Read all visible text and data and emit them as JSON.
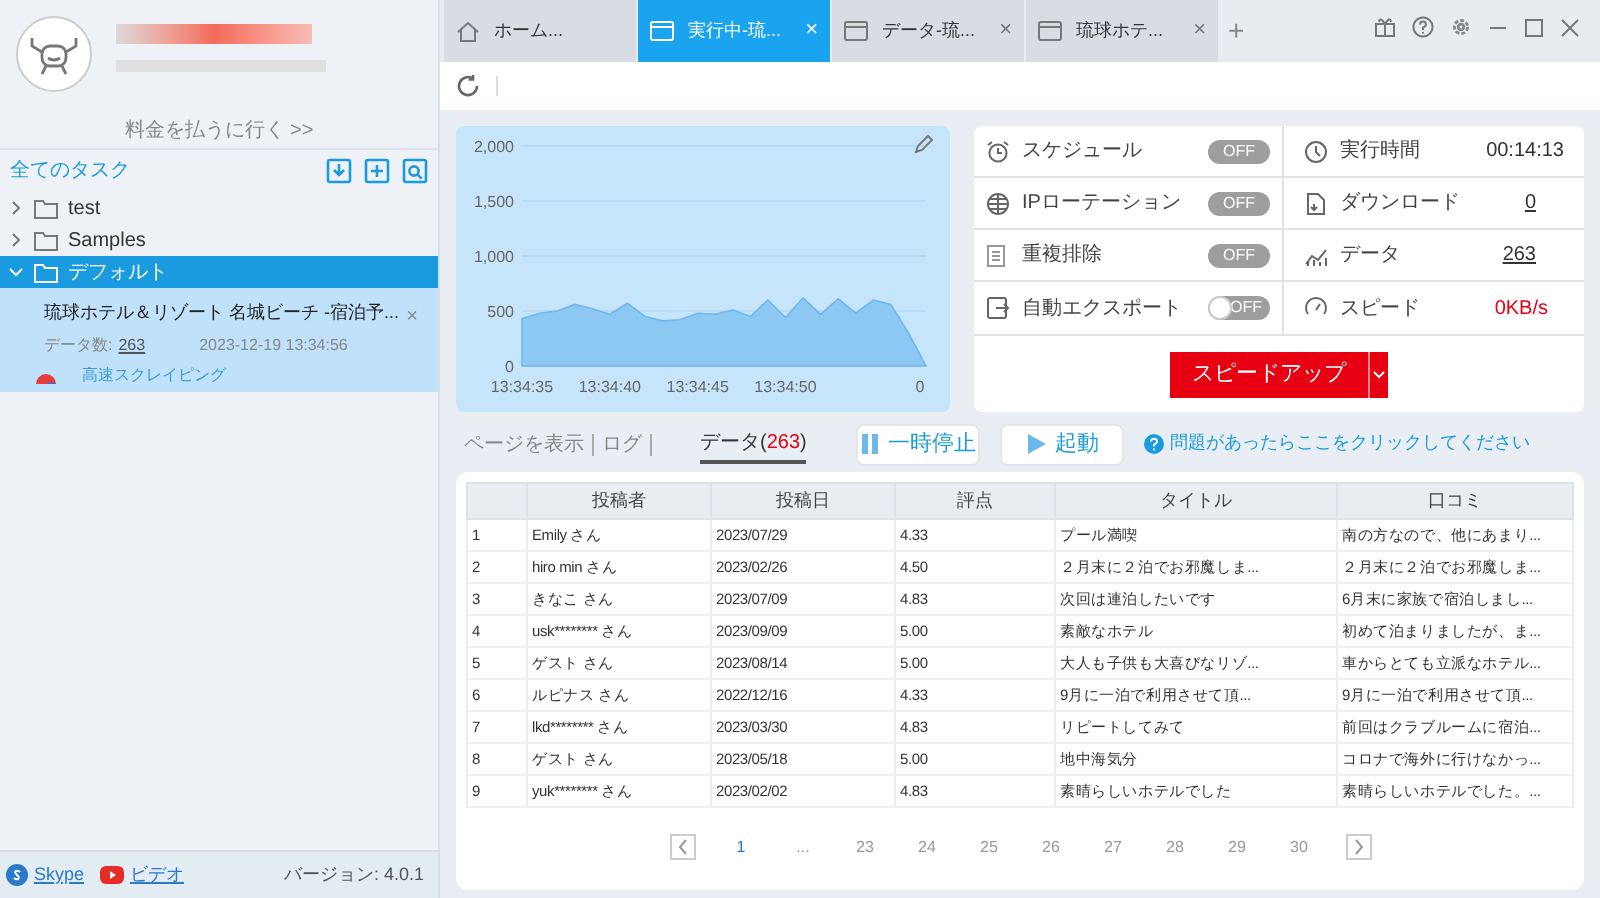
{
  "account": {
    "pay_link": "料金を払うに行く >>"
  },
  "sidebar": {
    "header": "全てのタスク",
    "folders": [
      {
        "name": "test",
        "expanded": false,
        "selected": false
      },
      {
        "name": "Samples",
        "expanded": false,
        "selected": false
      },
      {
        "name": "デフォルト",
        "expanded": true,
        "selected": true,
        "children": [
          {
            "title": "琉球ホテル＆リゾート 名城ビーチ -宿泊予...",
            "count_label": "データ数:",
            "count": "263",
            "date": "2023-12-19 13:34:56",
            "mode": "高速スクレイピング",
            "close": "×"
          }
        ]
      }
    ],
    "footer": {
      "links": [
        {
          "label": "Skype",
          "kind": "skype"
        },
        {
          "label": "ビデオ",
          "kind": "video"
        }
      ],
      "version": "バージョン: 4.0.1"
    }
  },
  "tabs": [
    {
      "label": "ホーム...",
      "kind": "home",
      "selected": false
    },
    {
      "label": "実行中-琉...",
      "kind": "page",
      "selected": true,
      "close": "×"
    },
    {
      "label": "データ-琉...",
      "kind": "page",
      "selected": false,
      "close": "×"
    },
    {
      "label": "琉球ホテ...",
      "kind": "page",
      "selected": false,
      "close": "×"
    }
  ],
  "new_tab": "+",
  "chart_data": {
    "type": "area",
    "grid": true,
    "categories": [
      "13:34:35",
      null,
      null,
      null,
      null,
      "13:34:40",
      null,
      null,
      null,
      null,
      "13:34:45",
      null,
      null,
      null,
      null,
      "13:34:50",
      null,
      null,
      null,
      null,
      null,
      null,
      null,
      "0"
    ],
    "series": [
      {
        "color": "#8cc8f2",
        "values": [
          430,
          480,
          500,
          560,
          520,
          470,
          570,
          450,
          410,
          420,
          480,
          470,
          510,
          450,
          600,
          440,
          620,
          470,
          610,
          480,
          600,
          560,
          300,
          0
        ]
      }
    ],
    "ylim": [
      0,
      2000
    ],
    "yticks": [
      {
        "value": 0,
        "label": "0"
      },
      {
        "value": 500,
        "label": "500"
      },
      {
        "value": 1000,
        "label": "1,000"
      },
      {
        "value": 1500,
        "label": "1,500"
      },
      {
        "value": 2000,
        "label": "2,000"
      }
    ]
  },
  "settings": [
    {
      "label": "スケジュール",
      "on": false,
      "kind": "pill",
      "toggle_label": "OFF"
    },
    {
      "label": "IPローテーション",
      "on": false,
      "kind": "pill",
      "toggle_label": "OFF"
    },
    {
      "label": "重複排除",
      "on": false,
      "kind": "pill",
      "toggle_label": "OFF"
    },
    {
      "label": "自動エクスポート",
      "on": false,
      "kind": "switch",
      "toggle_label": "OFF"
    }
  ],
  "stats": [
    {
      "label": "実行時間",
      "value": "00:14:13",
      "kind": "text"
    },
    {
      "label": "ダウンロード",
      "value": "0",
      "kind": "link"
    },
    {
      "label": "データ",
      "value": "263",
      "kind": "link"
    },
    {
      "label": "スピード",
      "value": "0KB/s",
      "kind": "alert"
    }
  ],
  "speed_button": "スピードアップ",
  "view_tabs": [
    {
      "label": "ページを表示",
      "selected": false
    },
    {
      "label": "ログ",
      "selected": false
    },
    {
      "label": "データ",
      "count_open": "(",
      "count": "263",
      "count_close": ")",
      "selected": true
    }
  ],
  "pause_button": "一時停止",
  "start_button": "起動",
  "help_link": "問題があったらここをクリックしてください",
  "table": {
    "columns": [
      "",
      "投稿者",
      "投稿日",
      "評点",
      "タイトル",
      "口コミ"
    ],
    "rows": [
      [
        "1",
        "Emily さん",
        "2023/07/29",
        "4.33",
        "プール満喫",
        "南の方なので、他にあまり..."
      ],
      [
        "2",
        "hiro min さん",
        "2023/02/26",
        "4.50",
        "２月末に２泊でお邪魔しま...",
        "２月末に２泊でお邪魔しま..."
      ],
      [
        "3",
        "きなこ さん",
        "2023/07/09",
        "4.83",
        "次回は連泊したいです",
        "6月末に家族で宿泊しまし..."
      ],
      [
        "4",
        "usk******** さん",
        "2023/09/09",
        "5.00",
        "素敵なホテル",
        "初めて泊まりましたが、ま..."
      ],
      [
        "5",
        "ゲスト さん",
        "2023/08/14",
        "5.00",
        "大人も子供も大喜びなリゾ...",
        "車からとても立派なホテル..."
      ],
      [
        "6",
        "ルピナス さん",
        "2022/12/16",
        "4.33",
        "9月に一泊で利用させて頂...",
        "9月に一泊で利用させて頂..."
      ],
      [
        "7",
        "lkd******** さん",
        "2023/03/30",
        "4.83",
        "リピートしてみて",
        "前回はクラブルームに宿泊..."
      ],
      [
        "8",
        "ゲスト さん",
        "2023/05/18",
        "5.00",
        "地中海気分",
        "コロナで海外に行けなかっ..."
      ],
      [
        "9",
        "yuk******** さん",
        "2023/02/02",
        "4.83",
        "素晴らしいホテルでした",
        "素晴らしいホテルでした。..."
      ]
    ]
  },
  "pagination": [
    {
      "label": "1",
      "selected": true
    },
    {
      "label": "...",
      "selected": false
    },
    {
      "label": "23",
      "selected": false
    },
    {
      "label": "24",
      "selected": false
    },
    {
      "label": "25",
      "selected": false
    },
    {
      "label": "26",
      "selected": false
    },
    {
      "label": "27",
      "selected": false
    },
    {
      "label": "28",
      "selected": false
    },
    {
      "label": "29",
      "selected": false
    },
    {
      "label": "30",
      "selected": false
    }
  ]
}
